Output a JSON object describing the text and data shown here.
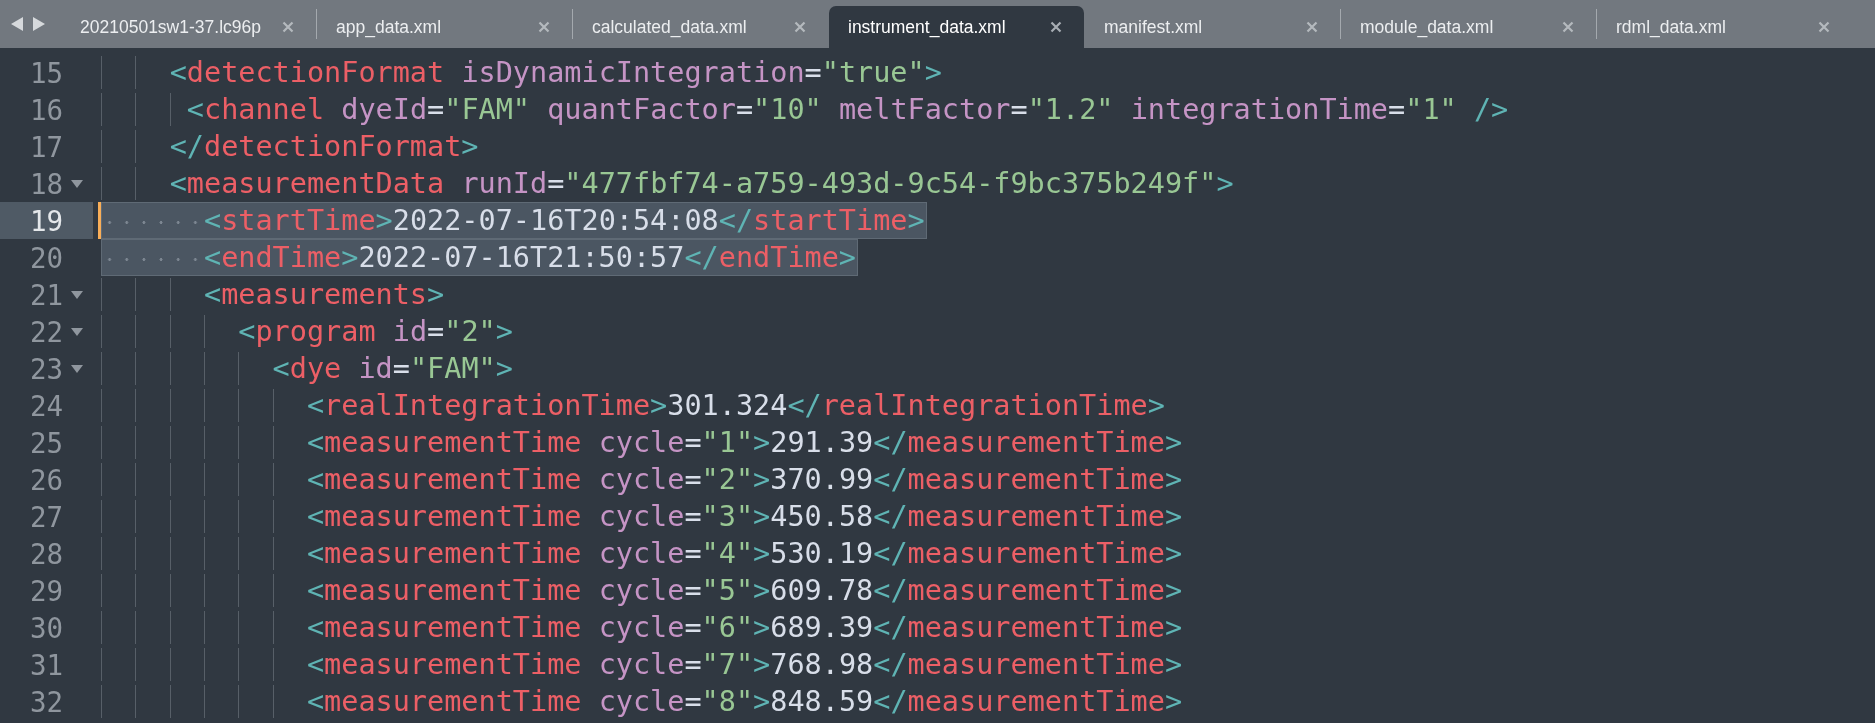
{
  "tabs": [
    {
      "label": "20210501sw1-37.lc96p",
      "selected": false
    },
    {
      "label": "app_data.xml",
      "selected": false
    },
    {
      "label": "calculated_data.xml",
      "selected": false
    },
    {
      "label": "instrument_data.xml",
      "selected": true
    },
    {
      "label": "manifest.xml",
      "selected": false
    },
    {
      "label": "module_data.xml",
      "selected": false
    },
    {
      "label": "rdml_data.xml",
      "selected": false
    }
  ],
  "lines": [
    {
      "number": "15",
      "foldable": false,
      "current": false,
      "selected": false,
      "modified": false,
      "code": "    <detectionFormat isDynamicIntegration=\"true\">"
    },
    {
      "number": "16",
      "foldable": false,
      "current": false,
      "selected": false,
      "modified": false,
      "code": "     <channel dyeId=\"FAM\" quantFactor=\"10\" meltFactor=\"1.2\" integrationTime=\"1\" />"
    },
    {
      "number": "17",
      "foldable": false,
      "current": false,
      "selected": false,
      "modified": false,
      "code": "    </detectionFormat>"
    },
    {
      "number": "18",
      "foldable": true,
      "current": false,
      "selected": false,
      "modified": false,
      "code": "    <measurementData runId=\"477fbf74-a759-493d-9c54-f9bc375b249f\">"
    },
    {
      "number": "19",
      "foldable": false,
      "current": true,
      "selected": true,
      "modified": true,
      "code": "      <startTime>2022-07-16T20:54:08</startTime>"
    },
    {
      "number": "20",
      "foldable": false,
      "current": false,
      "selected": true,
      "modified": false,
      "code": "      <endTime>2022-07-16T21:50:57</endTime>"
    },
    {
      "number": "21",
      "foldable": true,
      "current": false,
      "selected": false,
      "modified": false,
      "code": "      <measurements>"
    },
    {
      "number": "22",
      "foldable": true,
      "current": false,
      "selected": false,
      "modified": false,
      "code": "        <program id=\"2\">"
    },
    {
      "number": "23",
      "foldable": true,
      "current": false,
      "selected": false,
      "modified": false,
      "code": "          <dye id=\"FAM\">"
    },
    {
      "number": "24",
      "foldable": false,
      "current": false,
      "selected": false,
      "modified": false,
      "code": "            <realIntegrationTime>301.324</realIntegrationTime>"
    },
    {
      "number": "25",
      "foldable": false,
      "current": false,
      "selected": false,
      "modified": false,
      "code": "            <measurementTime cycle=\"1\">291.39</measurementTime>"
    },
    {
      "number": "26",
      "foldable": false,
      "current": false,
      "selected": false,
      "modified": false,
      "code": "            <measurementTime cycle=\"2\">370.99</measurementTime>"
    },
    {
      "number": "27",
      "foldable": false,
      "current": false,
      "selected": false,
      "modified": false,
      "code": "            <measurementTime cycle=\"3\">450.58</measurementTime>"
    },
    {
      "number": "28",
      "foldable": false,
      "current": false,
      "selected": false,
      "modified": false,
      "code": "            <measurementTime cycle=\"4\">530.19</measurementTime>"
    },
    {
      "number": "29",
      "foldable": false,
      "current": false,
      "selected": false,
      "modified": false,
      "code": "            <measurementTime cycle=\"5\">609.78</measurementTime>"
    },
    {
      "number": "30",
      "foldable": false,
      "current": false,
      "selected": false,
      "modified": false,
      "code": "            <measurementTime cycle=\"6\">689.39</measurementTime>"
    },
    {
      "number": "31",
      "foldable": false,
      "current": false,
      "selected": false,
      "modified": false,
      "code": "            <measurementTime cycle=\"7\">768.98</measurementTime>"
    },
    {
      "number": "32",
      "foldable": false,
      "current": false,
      "selected": false,
      "modified": false,
      "code": "            <measurementTime cycle=\"8\">848.59</measurementTime>"
    }
  ]
}
